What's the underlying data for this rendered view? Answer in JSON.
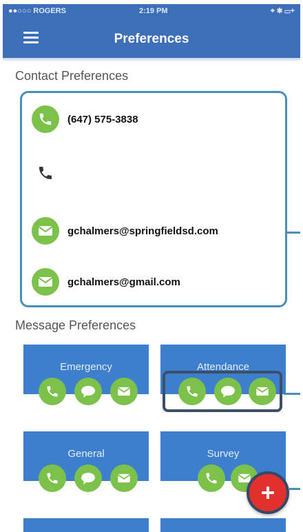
{
  "status_bar": {
    "carrier": "●●○○○ ROGERS",
    "time": "2:19 PM",
    "right": "⌖ ✱ ▭+"
  },
  "header": {
    "title": "Preferences"
  },
  "contact_section": {
    "title": "Contact Preferences",
    "items": [
      {
        "icon": "phone-icon",
        "value": "(647) 575-3838"
      },
      {
        "icon": "phone-outline-icon",
        "value": ""
      },
      {
        "icon": "email-icon",
        "value": "gchalmers@springfieldsd.com"
      },
      {
        "icon": "email-icon",
        "value": "gchalmers@gmail.com"
      }
    ]
  },
  "message_section": {
    "title": "Message Preferences",
    "tiles": [
      {
        "label": "Emergency"
      },
      {
        "label": "Attendance"
      },
      {
        "label": "General"
      },
      {
        "label": "Survey"
      }
    ]
  },
  "colors": {
    "header": "#3d6fb8",
    "tile": "#3d7fcc",
    "accent": "#7cc24a",
    "fab": "#e0312d",
    "border": "#4a8fb5"
  }
}
